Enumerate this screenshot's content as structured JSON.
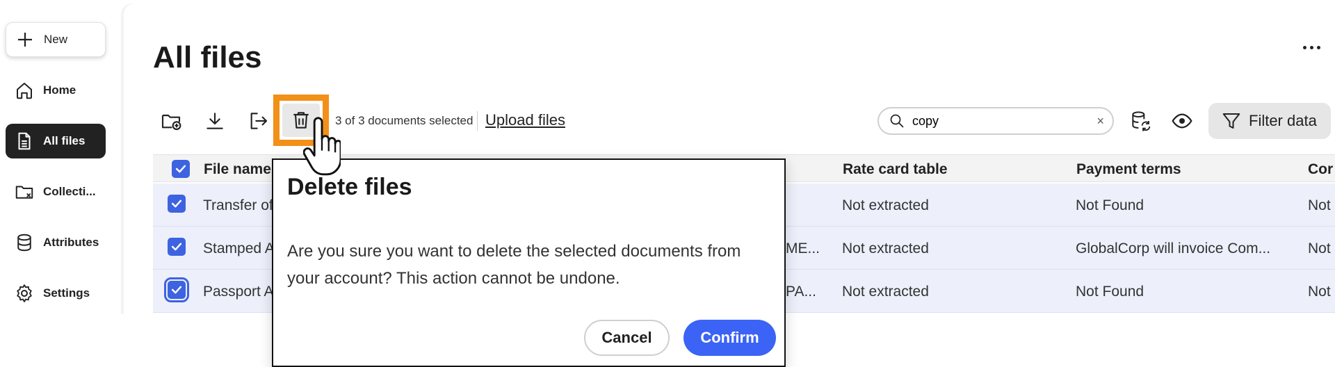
{
  "sidebar": {
    "items": [
      {
        "label": "New",
        "icon": "plus-icon"
      },
      {
        "label": "Home",
        "icon": "home-icon"
      },
      {
        "label": "All files",
        "icon": "document-icon",
        "active": true
      },
      {
        "label": "Collecti...",
        "icon": "folder-icon"
      },
      {
        "label": "Attributes",
        "icon": "database-icon"
      },
      {
        "label": "Settings",
        "icon": "gear-icon"
      }
    ]
  },
  "header": {
    "title": "All files",
    "more_icon": "more-icon"
  },
  "toolbar": {
    "icons": [
      "add-folder-icon",
      "download-icon",
      "export-icon",
      "trash-icon"
    ],
    "selection_text": "3 of 3 documents selected",
    "upload_label": "Upload files",
    "search_value": "copy",
    "search_clear": "×",
    "right_icons": [
      "database-refresh-icon",
      "eye-icon"
    ],
    "filter_label": "Filter data"
  },
  "table": {
    "headers": [
      "File name",
      "Rate card table",
      "Payment terms",
      "Cor"
    ],
    "rows": [
      {
        "file_name": "Transfer of",
        "col_hidden": "",
        "rate_card": "Not extracted",
        "payment_terms": "Not Found",
        "cor": "Not"
      },
      {
        "file_name": "Stamped A",
        "col_hidden": "ME...",
        "rate_card": "Not extracted",
        "payment_terms": "GlobalCorp will invoice Com...",
        "cor": "Not"
      },
      {
        "file_name": "Passport A",
        "col_hidden": "PA...",
        "rate_card": "Not extracted",
        "payment_terms": "Not Found",
        "cor": "Not"
      }
    ]
  },
  "dialog": {
    "title": "Delete files",
    "body": "Are you sure you want to delete the selected documents from your account? This action cannot be undone.",
    "cancel_label": "Cancel",
    "confirm_label": "Confirm"
  },
  "colors": {
    "accent": "#3b63f5",
    "highlight": "#f29018",
    "row_selected": "#edf0fb",
    "sidebar_active": "#222222"
  }
}
